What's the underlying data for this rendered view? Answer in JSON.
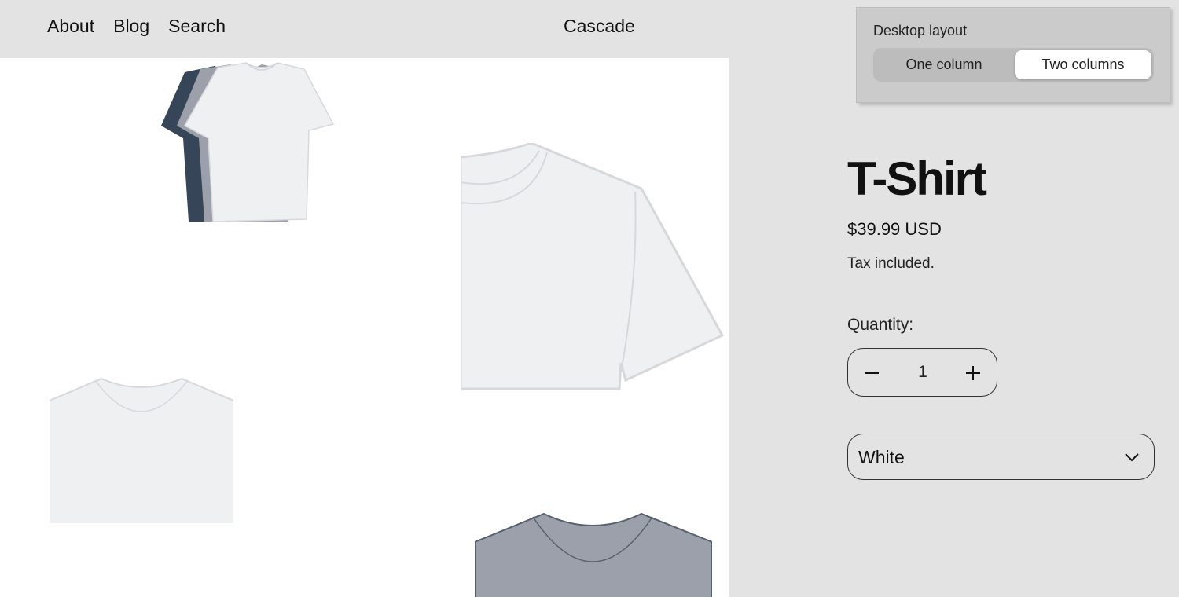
{
  "header": {
    "nav": [
      "About",
      "Blog",
      "Search"
    ],
    "brand": "Cascade"
  },
  "layout_panel": {
    "title": "Desktop layout",
    "options": [
      "One column",
      "Two columns"
    ],
    "selected": "Two columns"
  },
  "product": {
    "title": "T-Shirt",
    "price": "$39.99 USD",
    "tax_note": "Tax included.",
    "quantity_label": "Quantity:",
    "quantity": "1",
    "variant": "White"
  },
  "colors": {
    "shirt_white": "#eef0f2",
    "shirt_grey": "#9ca0aa",
    "shirt_navy": "#374559",
    "page_bg": "#e3e3e3"
  },
  "icons": {
    "minus": "minus-icon",
    "plus": "plus-icon",
    "chevron": "chevron-down-icon"
  }
}
